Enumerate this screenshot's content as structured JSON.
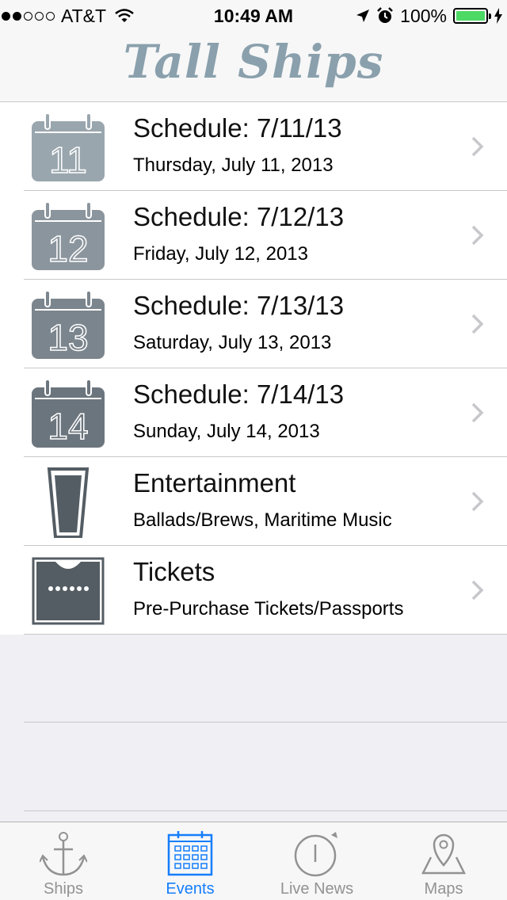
{
  "status": {
    "carrier": "AT&T",
    "time": "10:49 AM",
    "battery": "100%"
  },
  "nav": {
    "title": "Tall Ships"
  },
  "rows": [
    {
      "icon": "calendar-icon",
      "day": "11",
      "title": "Schedule: 7/11/13",
      "subtitle": "Thursday, July 11, 2013"
    },
    {
      "icon": "calendar-icon",
      "day": "12",
      "title": "Schedule: 7/12/13",
      "subtitle": "Friday, July 12, 2013"
    },
    {
      "icon": "calendar-icon",
      "day": "13",
      "title": "Schedule: 7/13/13",
      "subtitle": "Saturday, July 13, 2013"
    },
    {
      "icon": "calendar-icon",
      "day": "14",
      "title": "Schedule: 7/14/13",
      "subtitle": "Sunday, July 14, 2013"
    },
    {
      "icon": "pint-glass-icon",
      "title": "Entertainment",
      "subtitle": "Ballads/Brews, Maritime Music"
    },
    {
      "icon": "ticket-icon",
      "title": "Tickets",
      "subtitle": "Pre-Purchase Tickets/Passports"
    }
  ],
  "tabs": [
    {
      "icon": "anchor-icon",
      "label": "Ships"
    },
    {
      "icon": "calendar-grid-icon",
      "label": "Events",
      "active": true
    },
    {
      "icon": "stopwatch-icon",
      "label": "Live News"
    },
    {
      "icon": "map-pin-icon",
      "label": "Maps"
    }
  ],
  "colors": {
    "accent": "#157efb",
    "title": "#8aa0ac",
    "battery": "#4cd964",
    "calendar_shades": [
      "#9aa6ae",
      "#8b959d",
      "#7b858d",
      "#6b757d"
    ],
    "icon_dark": "#545d64"
  }
}
